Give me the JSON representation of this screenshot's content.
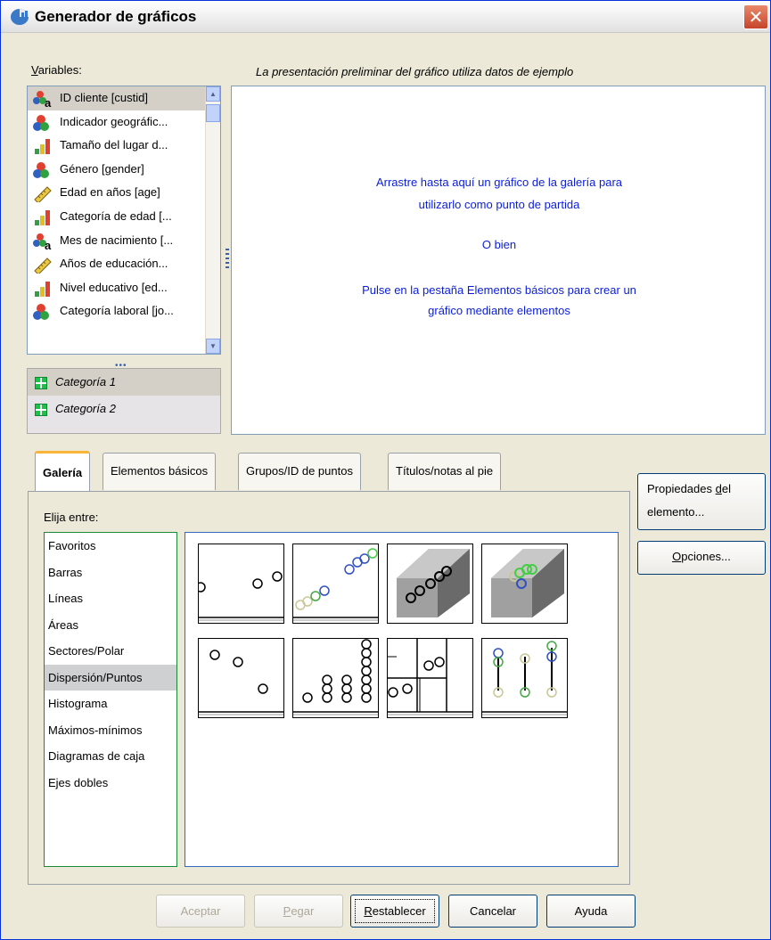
{
  "window": {
    "title": "Generador de gráficos"
  },
  "variables": {
    "label_prefix": "V",
    "label_rest": "ariables:",
    "items": [
      {
        "label": "ID cliente [custid]",
        "icon": "nominal-string-icon"
      },
      {
        "label": "Indicador geográfic...",
        "icon": "nominal-icon"
      },
      {
        "label": "Tamaño del lugar d...",
        "icon": "ordinal-icon"
      },
      {
        "label": "Género [gender]",
        "icon": "nominal-icon"
      },
      {
        "label": "Edad en años [age]",
        "icon": "scale-icon"
      },
      {
        "label": "Categoría de edad [...",
        "icon": "ordinal-icon"
      },
      {
        "label": "Mes de nacimiento [...",
        "icon": "nominal-string-icon"
      },
      {
        "label": "Años de educación...",
        "icon": "scale-icon"
      },
      {
        "label": "Nivel educativo [ed...",
        "icon": "ordinal-icon"
      },
      {
        "label": "Categoría laboral [jo...",
        "icon": "nominal-icon"
      }
    ]
  },
  "categories": {
    "items": [
      "Categoría 1",
      "Categoría 2"
    ]
  },
  "preview": {
    "note": "La presentación preliminar del gráfico utiliza datos de ejemplo",
    "line1": "Arrastre hasta aquí un gráfico de la galería para",
    "line2": "utilizarlo como punto de partida",
    "line3": "O bien",
    "line4": "Pulse en la pestaña Elementos básicos para crear un",
    "line5": "gráfico mediante elementos"
  },
  "tabs": [
    {
      "label": "Galería",
      "active": true
    },
    {
      "label": "Elementos básicos",
      "active": false
    },
    {
      "label": "Grupos/ID de puntos",
      "active": false
    },
    {
      "label": "Títulos/notas al pie",
      "active": false
    }
  ],
  "gallery": {
    "choose_label": "Elija entre:",
    "types": [
      "Favoritos",
      "Barras",
      "Líneas",
      "Áreas",
      "Sectores/Polar",
      "Dispersión/Puntos",
      "Histograma",
      "Máximos-mínimos",
      "Diagramas de caja",
      "Ejes dobles"
    ],
    "selected_type": "Dispersión/Puntos"
  },
  "side_buttons": {
    "properties_a": "Propiedades ",
    "properties_b": "d",
    "properties_c": "el",
    "properties_d": "elemento...",
    "options_a": "",
    "options_b": "O",
    "options_c": "pciones..."
  },
  "bottom_buttons": {
    "accept": "Aceptar",
    "paste_a": "P",
    "paste_b": "egar",
    "reset_a": "R",
    "reset_b": "establecer",
    "cancel": "Cancelar",
    "help": "Ayuda"
  },
  "colors": {
    "preview_text": "#0a1ed8",
    "tab_accent": "#f9b537",
    "close_red": "#c6442a"
  }
}
